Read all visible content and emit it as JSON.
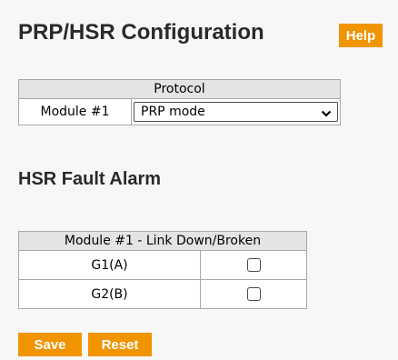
{
  "header": {
    "title": "PRP/HSR Configuration",
    "help_label": "Help"
  },
  "protocol": {
    "header": "Protocol",
    "module_label": "Module #1",
    "selected_value": "PRP mode"
  },
  "fault_alarm": {
    "title": "HSR Fault Alarm",
    "header": "Module #1 - Link Down/Broken",
    "rows": [
      {
        "label": "G1(A)",
        "checked": false
      },
      {
        "label": "G2(B)",
        "checked": false
      }
    ]
  },
  "actions": {
    "save_label": "Save",
    "reset_label": "Reset"
  },
  "colors": {
    "accent": "#f09400",
    "header_bg": "#e4e4e4",
    "page_bg": "#f7f7f7"
  }
}
